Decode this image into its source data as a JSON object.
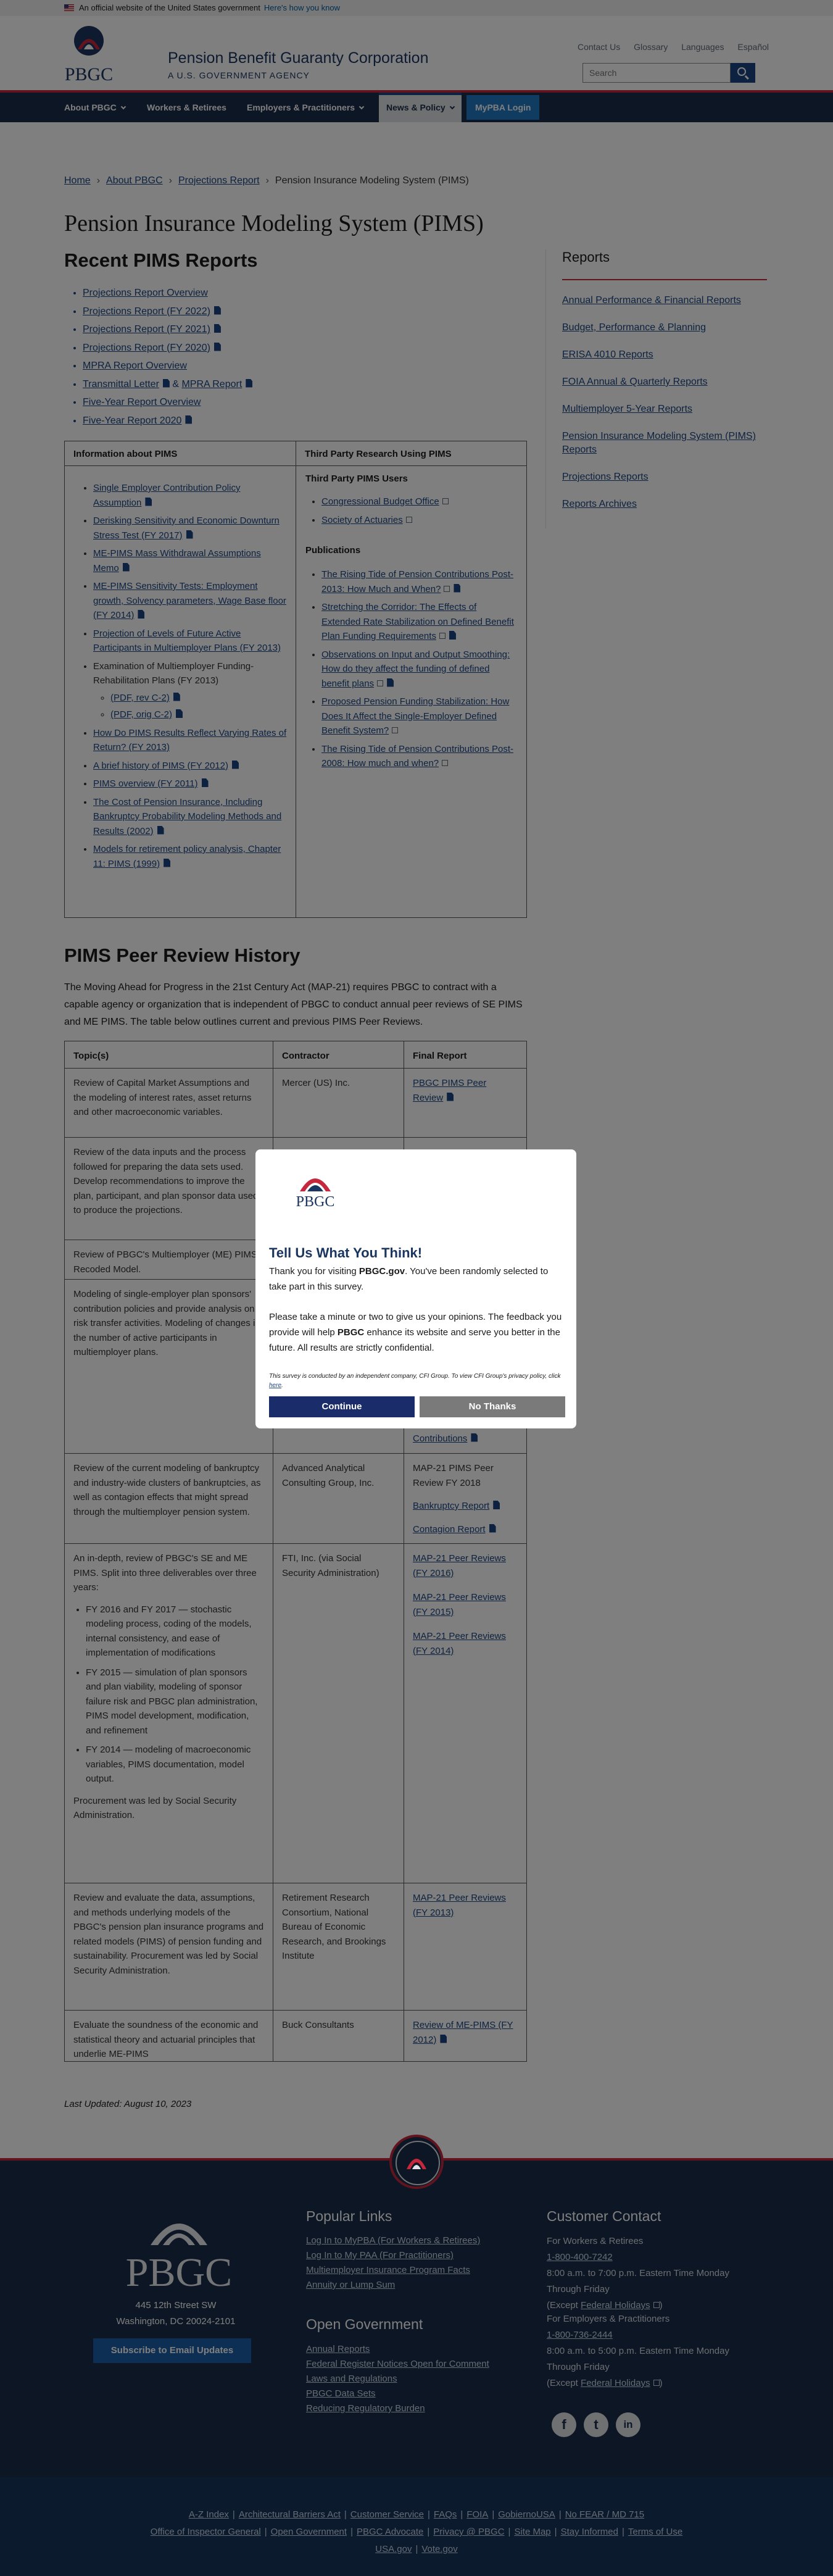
{
  "gov_banner": {
    "text": "An official website of the United States government",
    "link": "Here's how you know"
  },
  "header": {
    "title": "Pension Benefit Guaranty Corporation",
    "subtitle": "A U.S. GOVERNMENT AGENCY",
    "utility": [
      "Contact Us",
      "Glossary",
      "Languages",
      "Español"
    ],
    "search_placeholder": "Search"
  },
  "nav": {
    "items": [
      "About PBGC",
      "Workers & Retirees",
      "Employers & Practitioners",
      "News & Policy",
      "MyPBA Login"
    ]
  },
  "breadcrumb": [
    "Home",
    "About PBGC",
    "Projections Report",
    "Pension Insurance Modeling System (PIMS)"
  ],
  "page_title": "Pension Insurance Modeling System (PIMS)",
  "recent": {
    "heading": "Recent PIMS Reports",
    "items": [
      "Projections Report Overview",
      "Projections Report (FY 2022)",
      "Projections Report (FY 2021)",
      "Projections Report (FY 2020)",
      "MPRA Report Overview",
      "Transmittal Letter",
      "MPRA Report",
      "Five-Year Report Overview",
      "Five-Year Report 2020"
    ]
  },
  "info_table": {
    "left_header": "Information about PIMS",
    "right_header": "Third Party Research Using PIMS",
    "left_items": [
      "Single Employer Contribution Policy Assumption",
      "Derisking Sensitivity and Economic Downturn Stress Test (FY 2017)",
      "ME-PIMS Mass Withdrawal Assumptions Memo",
      "ME-PIMS Sensitivity Tests: Employment growth, Solvency parameters, Wage Base floor (FY 2014)",
      "Projection of Levels of Future Active Participants in Multiemployer Plans (FY 2013)",
      "Examination of Multiemployer Funding-Rehabilitation Plans (FY 2013)",
      "(PDF, rev C-2)",
      "(PDF, orig C-2)",
      "How Do PIMS Results Reflect Varying Rates of Return? (FY 2013)",
      "A brief history of PIMS (FY 2012)",
      "PIMS overview (FY 2011)",
      "The Cost of Pension Insurance, Including Bankruptcy Probability Modeling Methods and Results (2002)",
      "Models for retirement policy analysis, Chapter 11: PIMS (1999)"
    ],
    "users_heading": "Third Party PIMS Users",
    "users": [
      "Congressional Budget Office",
      "Society of Actuaries"
    ],
    "pubs_heading": "Publications",
    "publications": [
      "The Rising Tide of Pension Contributions Post-2013: How Much and When?",
      "Stretching the Corridor: The Effects of Extended Rate Stabilization on Defined Benefit Plan Funding Requirements",
      "Observations on Input and Output Smoothing: How do they affect the funding of defined benefit plans",
      "Proposed Pension Funding Stabilization: How Does It Affect the Single-Employer Defined Benefit System?",
      "The Rising Tide of Pension Contributions Post-2008: How much and when?"
    ]
  },
  "peer": {
    "heading": "PIMS Peer Review History",
    "intro": "The Moving Ahead for Progress in the 21st Century Act (MAP-21) requires PBGC to contract with a capable agency or organization that is independent of PBGC to conduct annual peer reviews of SE PIMS and ME PIMS. The table below outlines current and previous PIMS Peer Reviews.",
    "headers": [
      "Topic(s)",
      "Contractor",
      "Final Report"
    ],
    "rows": [
      {
        "topic": "Review of Capital Market Assumptions and the modeling of interest rates, asset returns and other macroeconomic variables.",
        "contractor": "Mercer (US) Inc.",
        "report": "PBGC PIMS Peer Review"
      },
      {
        "topic": "Review of the data inputs and the process followed for preparing the data sets used. Develop recommendations to improve the plan, participant, and plan sponsor data used to produce the projections."
      },
      {
        "topic": "Review of PBGC's Multiemployer (ME) PIMS Recoded Model."
      },
      {
        "topic": "Modeling of single-employer plan sponsors' contribution policies and provide analysis on risk transfer activities. Modeling of changes in the number of active participants in multiemployer plans.",
        "report": "Contributions"
      },
      {
        "topic": "Review of the current modeling of bankruptcy and industry-wide clusters of bankruptcies, as well as contagion effects that might spread through the multiemployer pension system.",
        "contractor": "Advanced Analytical Consulting Group, Inc.",
        "report_text": "MAP-21 PIMS Peer Review FY 2018",
        "links": [
          "Bankruptcy Report",
          "Contagion Report"
        ]
      },
      {
        "topic": "An in-depth, review of PBGC's SE and ME PIMS. Split into three deliverables over three years:",
        "bullets": [
          "FY 2016 and FY 2017 — stochastic modeling process, coding of the models, internal consistency, and ease of implementation of modifications",
          "FY 2015 — simulation of plan sponsors and plan viability, modeling of sponsor failure risk and PBGC plan administration, PIMS model development, modification, and refinement",
          "FY 2014 — modeling of macroeconomic variables, PIMS documentation, model output."
        ],
        "topic_end": "Procurement was led by Social Security Administration.",
        "contractor": "FTI, Inc. (via Social Security Administration)",
        "links": [
          "MAP-21 Peer Reviews (FY 2016)",
          "MAP-21 Peer Reviews (FY 2015)",
          "MAP-21 Peer Reviews (FY 2014)"
        ]
      },
      {
        "topic": "Review and evaluate the data, assumptions, and methods underlying models of the PBGC's pension plan insurance programs and related models (PIMS) of pension funding and sustainability. Procurement was led by Social Security Administration.",
        "contractor": "Retirement Research Consortium, National Bureau of Economic Research, and Brookings Institute",
        "report": "MAP-21 Peer Reviews (FY 2013)"
      },
      {
        "topic": "Evaluate the soundness of the economic and statistical theory and actuarial principles that underlie ME-PIMS",
        "contractor": "Buck Consultants",
        "report": "Review of ME-PIMS (FY 2012)"
      }
    ]
  },
  "sidebar": {
    "title": "Reports",
    "items": [
      "Annual Performance & Financial Reports",
      "Budget, Performance & Planning",
      "ERISA 4010 Reports",
      "FOIA Annual & Quarterly Reports",
      "Multiemployer 5-Year Reports",
      "Pension Insurance Modeling System (PIMS) Reports",
      "Projections Reports",
      "Reports Archives"
    ]
  },
  "last_updated": "Last Updated: August 10, 2023",
  "modal": {
    "title": "Tell Us What You Think!",
    "body1_pre": "Thank you for visiting ",
    "body1_bold": "PBGC.gov",
    "body1_post": ". You've been randomly selected to take part in this survey.",
    "body2_pre": "Please take a minute or two to give us your opinions. The feedback you provide will help ",
    "body2_bold": "PBGC",
    "body2_post": " enhance its website and serve you better in the future. All results are strictly confidential.",
    "fine": "This survey is conducted by an independent company, CFI Group. To view CFI Group's privacy policy, click",
    "fine_link": "here",
    "continue": "Continue",
    "no_thanks": "No Thanks"
  },
  "footer": {
    "logo_text": "PBGC",
    "address1": "445 12th Street SW",
    "address2": "Washington, DC 20024-2101",
    "subscribe": "Subscribe to Email Updates",
    "popular_heading": "Popular Links",
    "popular": [
      "Log In to MyPBA (For Workers & Retirees)",
      "Log In to My PAA (For Practitioners)",
      "Multiemployer Insurance Program Facts",
      "Annuity or Lump Sum"
    ],
    "open_heading": "Open Government",
    "open": [
      "Annual Reports",
      "Federal Register Notices Open for Comment",
      "Laws and Regulations",
      "PBGC Data Sets",
      "Reducing Regulatory Burden"
    ],
    "contact_heading": "Customer Contact",
    "wr_label": "For Workers & Retirees",
    "wr_phone": "1-800-400-7242",
    "wr_hours": "8:00 a.m. to 7:00 p.m. Eastern Time Monday Through Friday",
    "holidays_pre": "(Except ",
    "holidays_link": "Federal Holidays",
    "holidays_post": ")",
    "ep_label": "For Employers & Practitioners",
    "ep_phone": "1-800-736-2444",
    "ep_hours": "8:00 a.m. to 5:00 p.m. Eastern Time Monday Through Friday",
    "social": [
      "f",
      "t",
      "in"
    ],
    "bottom_row1": [
      "A-Z Index",
      "Architectural Barriers Act",
      "Customer Service",
      "FAQs",
      "FOIA",
      "GobiernoUSA",
      "No FEAR / MD 715"
    ],
    "bottom_row2": [
      "Office of Inspector General",
      "Open Government",
      "PBGC Advocate",
      "Privacy @ PBGC",
      "Site Map",
      "Stay Informed",
      "Terms of Use"
    ],
    "bottom_row3": [
      "USA.gov",
      "Vote.gov"
    ]
  }
}
